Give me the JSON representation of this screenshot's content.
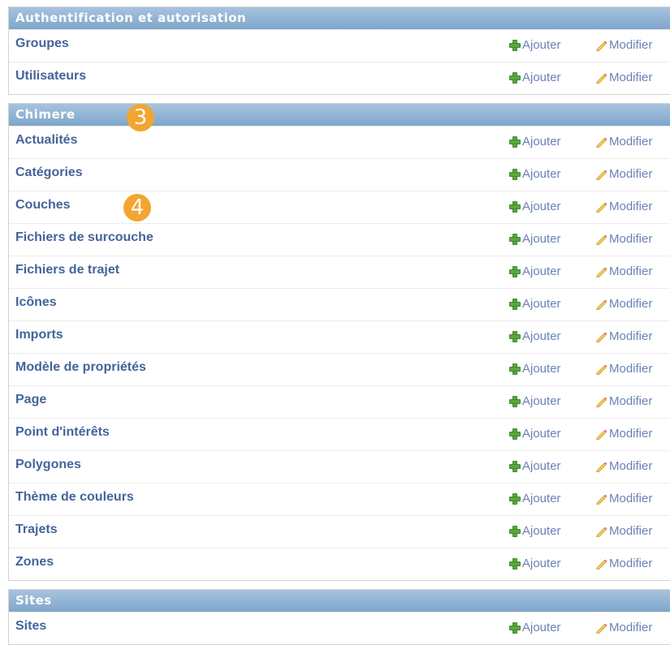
{
  "actions": {
    "add": "Ajouter",
    "change": "Modifier"
  },
  "modules": [
    {
      "title": "Authentification et autorisation",
      "models": [
        "Groupes",
        "Utilisateurs"
      ]
    },
    {
      "title": "Chimere",
      "models": [
        "Actualités",
        "Catégories",
        "Couches",
        "Fichiers de surcouche",
        "Fichiers de trajet",
        "Icônes",
        "Imports",
        "Modèle de propriétés",
        "Page",
        "Point d'intérêts",
        "Polygones",
        "Thème de couleurs",
        "Trajets",
        "Zones"
      ]
    },
    {
      "title": "Sites",
      "models": [
        "Sites"
      ]
    }
  ],
  "badges": {
    "b3": "3",
    "b4": "4"
  },
  "colors": {
    "header": "#8fb1d4",
    "link": "#44649b",
    "action": "#6a83b4",
    "badge": "#f2a531"
  }
}
